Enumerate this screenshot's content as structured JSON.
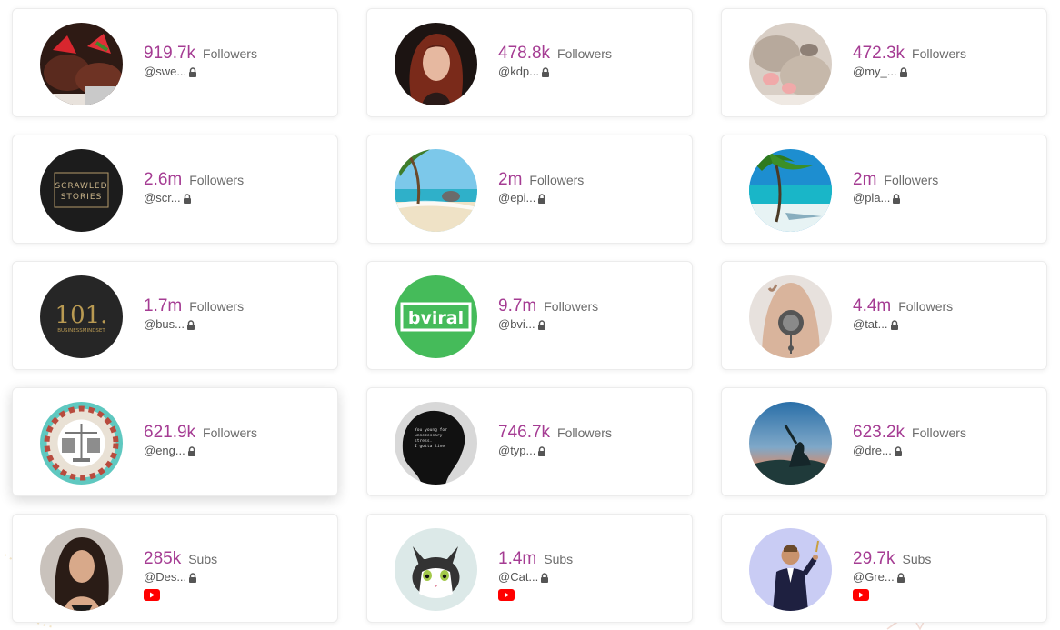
{
  "accent_color": "#a53c93",
  "cards": [
    {
      "count": "919.7k",
      "label": "Followers",
      "handle": "@swe...",
      "avatar": "dessert-strawberry-photo",
      "platform": "instagram"
    },
    {
      "count": "478.8k",
      "label": "Followers",
      "handle": "@kdp...",
      "avatar": "red-hair-portrait-photo",
      "platform": "instagram"
    },
    {
      "count": "472.3k",
      "label": "Followers",
      "handle": "@my_...",
      "avatar": "sleeping-kittens-photo",
      "platform": "instagram"
    },
    {
      "count": "2.6m",
      "label": "Followers",
      "handle": "@scr...",
      "avatar": "scrawled-stories-logo",
      "logo_text_1": "SCRAWLED",
      "logo_text_2": "STORIES",
      "platform": "instagram"
    },
    {
      "count": "2m",
      "label": "Followers",
      "handle": "@epi...",
      "avatar": "tropical-beach-photo",
      "platform": "instagram"
    },
    {
      "count": "2m",
      "label": "Followers",
      "handle": "@pla...",
      "avatar": "palm-beach-photo",
      "platform": "instagram"
    },
    {
      "count": "1.7m",
      "label": "Followers",
      "handle": "@bus...",
      "avatar": "business-mindset-logo",
      "logo_text_1": "101.",
      "logo_text_2": "BUSINESSMINDSET",
      "platform": "instagram"
    },
    {
      "count": "9.7m",
      "label": "Followers",
      "handle": "@bvi...",
      "avatar": "bviral-logo",
      "logo_text_1": "bviral",
      "platform": "instagram"
    },
    {
      "count": "4.4m",
      "label": "Followers",
      "handle": "@tat...",
      "avatar": "back-tattoo-photo",
      "platform": "instagram"
    },
    {
      "count": "621.9k",
      "label": "Followers",
      "handle": "@eng...",
      "avatar": "engineering-illustration",
      "platform": "instagram"
    },
    {
      "count": "746.7k",
      "label": "Followers",
      "handle": "@typ...",
      "avatar": "typewriter-quote-photo",
      "logo_text_1": "You young for",
      "logo_text_2": "unnecessary",
      "logo_text_3": "stress.",
      "logo_text_4": "I gotta live",
      "platform": "instagram"
    },
    {
      "count": "623.2k",
      "label": "Followers",
      "handle": "@dre...",
      "avatar": "sky-silhouette-photo",
      "platform": "instagram"
    },
    {
      "count": "285k",
      "label": "Subs",
      "handle": "@Des...",
      "avatar": "woman-portrait-photo",
      "platform": "youtube"
    },
    {
      "count": "1.4m",
      "label": "Subs",
      "handle": "@Cat...",
      "avatar": "cartoon-cat-illustration",
      "platform": "youtube"
    },
    {
      "count": "29.7k",
      "label": "Subs",
      "handle": "@Gre...",
      "avatar": "man-in-suit-photo",
      "platform": "youtube"
    }
  ]
}
